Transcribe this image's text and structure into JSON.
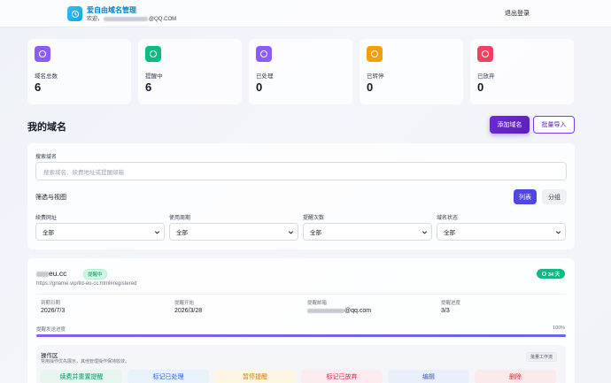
{
  "header": {
    "app_title": "爱自由域名管理",
    "welcome_prefix": "欢迎，",
    "welcome_suffix": "@QQ.COM",
    "logout_label": "退出登录"
  },
  "stats": [
    {
      "label": "域名总数",
      "value": "6",
      "color": "#8b5cf6"
    },
    {
      "label": "提醒中",
      "value": "6",
      "color": "#10b981"
    },
    {
      "label": "已处理",
      "value": "0",
      "color": "#8b5cf6"
    },
    {
      "label": "已转停",
      "value": "0",
      "color": "#f59e0b"
    },
    {
      "label": "已放弃",
      "value": "0",
      "color": "#f43f5e"
    }
  ],
  "main": {
    "title": "我的域名",
    "add_label": "添加域名",
    "import_label": "批量导入"
  },
  "filters": {
    "search_label": "搜索域名",
    "search_placeholder": "搜索域名、续费地址或提醒邮箱",
    "section_title": "筛选与视图",
    "view_list": "列表",
    "view_group": "分组",
    "selects": [
      {
        "label": "续费网址",
        "value": "全部"
      },
      {
        "label": "使用周期",
        "value": "全部"
      },
      {
        "label": "提醒次数",
        "value": "全部"
      },
      {
        "label": "域名状态",
        "value": "全部"
      }
    ]
  },
  "domain": {
    "name_suffix": "eu.cc",
    "status_badge": "提醒中",
    "days_left": "34 天",
    "url": "https://gname.vip/tld-eu-cc.html#registered",
    "info": [
      {
        "label": "到期日期",
        "value": "2026/7/3"
      },
      {
        "label": "提醒开始",
        "value": "2026/3/28"
      },
      {
        "label": "提醒邮箱",
        "value": "@qq.com"
      },
      {
        "label": "提醒进度",
        "value": "3/3"
      }
    ],
    "progress_label": "提醒发送进度",
    "progress_text": "100%",
    "progress": 1.0,
    "ops_title": "操作区",
    "ops_sub": "常用操作优先展示，其他管理操作保持收敛。",
    "ops_tag": "批量工作流",
    "actions": [
      {
        "label": "续费并重置提醒",
        "bg": "#e6f6ee",
        "fg": "#059669"
      },
      {
        "label": "标记已处理",
        "bg": "#e8f2fb",
        "fg": "#2563eb"
      },
      {
        "label": "暂停提醒",
        "bg": "#fdf6e3",
        "fg": "#d97706"
      },
      {
        "label": "标记已放弃",
        "bg": "#fdecef",
        "fg": "#e11d48"
      },
      {
        "label": "编辑",
        "bg": "#eaf0fb",
        "fg": "#3b5bdb"
      },
      {
        "label": "删除",
        "bg": "#fbeaec",
        "fg": "#dc2626"
      }
    ]
  }
}
